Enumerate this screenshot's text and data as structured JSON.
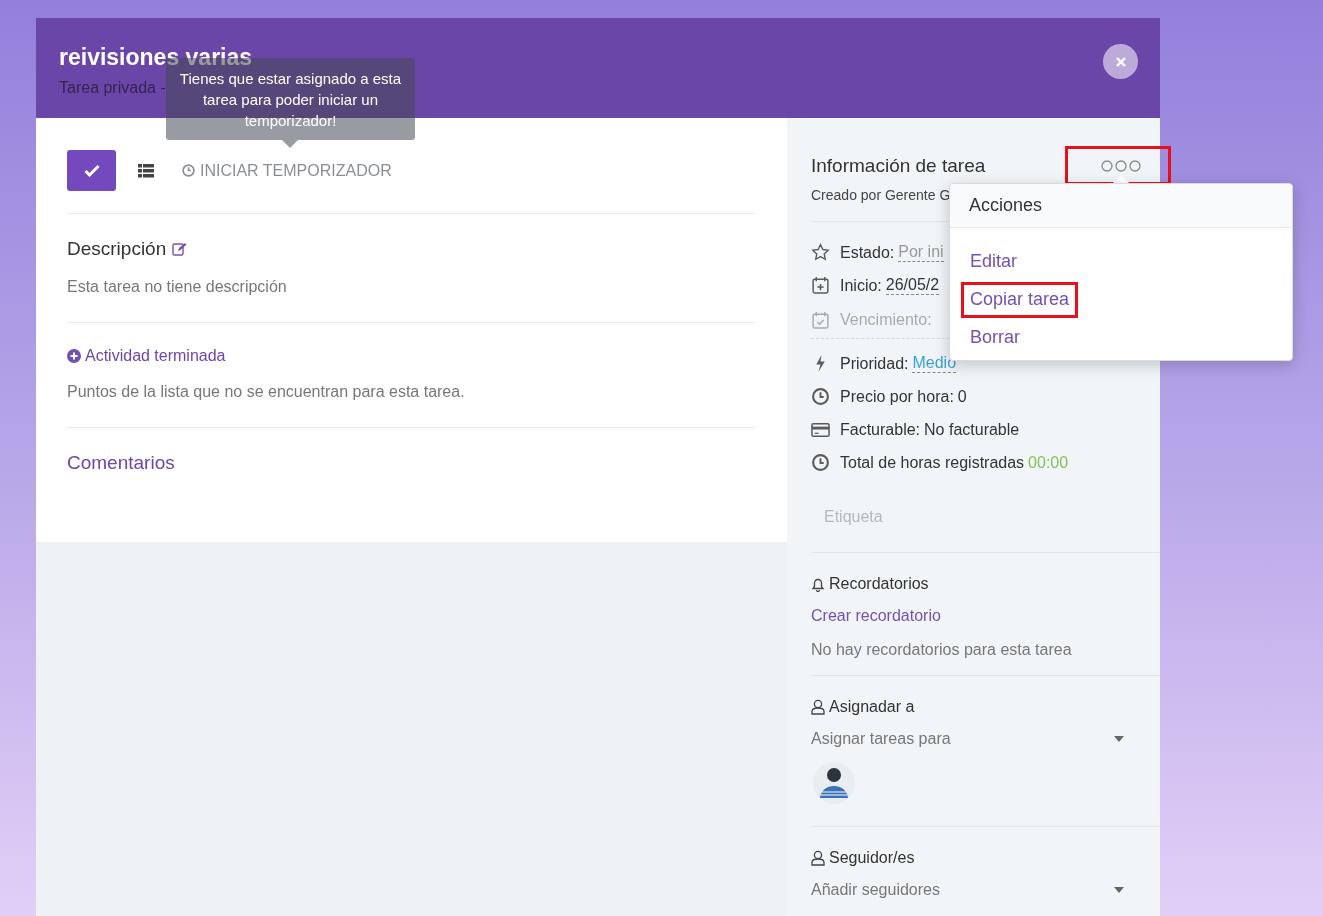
{
  "modal": {
    "title": "reivisiones varias",
    "subtitle": "Tarea privada -"
  },
  "tooltip": {
    "text": "Tienes que estar asignado a esta tarea para poder iniciar un temporizador!"
  },
  "toolbar": {
    "timer_button": "INICIAR TEMPORIZADOR"
  },
  "description": {
    "heading": "Descripción",
    "text": "Esta tarea no tiene descripción"
  },
  "checklist": {
    "heading": "Actividad terminada",
    "text": "Puntos de la lista que no se encuentran para esta tarea."
  },
  "comments": {
    "heading": "Comentarios"
  },
  "task_info": {
    "heading": "Información de tarea",
    "more_button": {
      "highlighted": true
    },
    "created_by": "Creado por Gerente G",
    "fields": [
      {
        "kind": "status",
        "label": "Estado:",
        "value": "Por ini",
        "disabled": false
      },
      {
        "kind": "start",
        "label": "Inicio:",
        "value": "26/05/2",
        "disabled": false
      },
      {
        "kind": "due",
        "label": "Vencimiento:",
        "disabled": true
      },
      {
        "kind": "priority",
        "label": "Prioridad:",
        "value": "Medio",
        "disabled": false
      },
      {
        "kind": "rate",
        "label": "Precio por hora:",
        "value": "0",
        "disabled": false
      },
      {
        "kind": "billable",
        "label": "Facturable:",
        "value": "No facturable",
        "disabled": false
      },
      {
        "kind": "hours",
        "label": "Total de horas registradas",
        "value": "00:00",
        "disabled": false
      }
    ],
    "tags_placeholder": "Etiqueta"
  },
  "reminders": {
    "heading": "Recordatorios",
    "create_link": "Crear recordatorio",
    "empty_text": "No hay recordatorios para esta tarea"
  },
  "assignees": {
    "heading": "Asignadar a",
    "placeholder": "Asignar tareas para"
  },
  "followers": {
    "heading": "Seguidor/es",
    "placeholder": "Añadir seguidores"
  },
  "menu": {
    "title": "Acciones",
    "items": [
      {
        "label": "Editar",
        "highlighted": false
      },
      {
        "label": "Copiar tarea",
        "highlighted": true
      },
      {
        "label": "Borrar",
        "highlighted": false
      }
    ]
  }
}
